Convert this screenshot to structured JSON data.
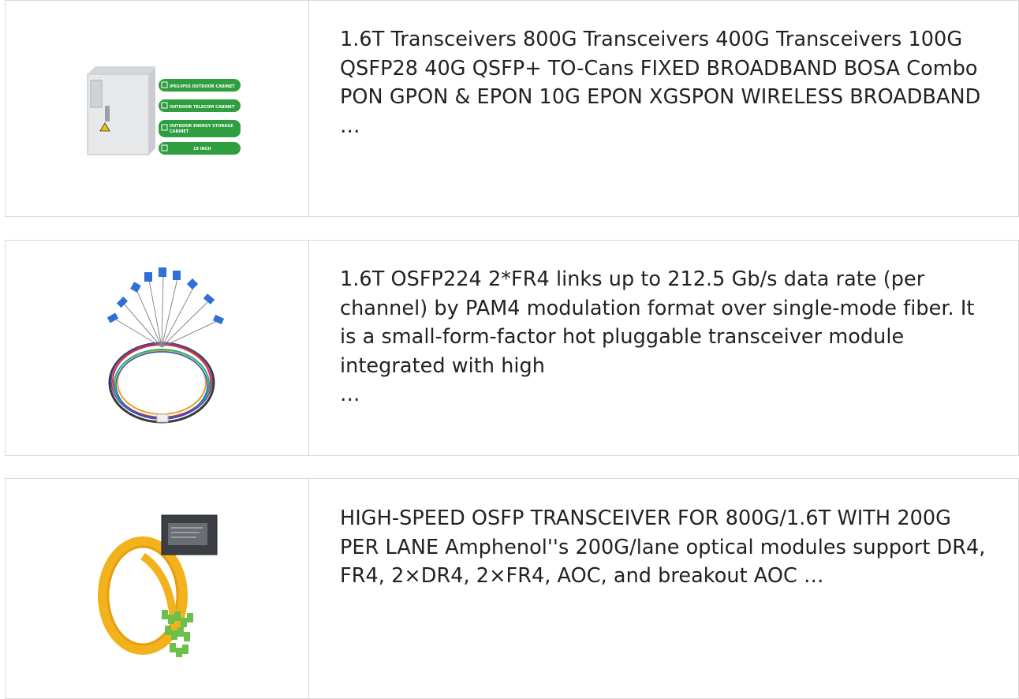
{
  "products": [
    {
      "image_caption": {
        "tags": [
          "IP65/IP55 OUTDOOR CABINET",
          "OUTDOOR TELECOM CABINET",
          "OUTDOOR ENERGY STORAGE CABINET",
          "19 INCH"
        ]
      },
      "text": "1.6T Transceivers 800G Transceivers 400G Transceivers 100G QSFP28 40G QSFP+ TO-Cans FIXED BROADBAND BOSA Combo PON GPON & EPON 10G EPON XGSPON WIRELESS BROADBAND",
      "ellipsis": "…"
    },
    {
      "text": "1.6T OSFP224 2*FR4 links up to 212.5 Gb/s data rate (per channel) by PAM4 modulation format over single-mode fiber. It is a small-form-factor hot pluggable transceiver module integrated with high",
      "ellipsis": "…"
    },
    {
      "text": "HIGH-SPEED OSFP TRANSCEIVER FOR 800G/1.6T WITH 200G PER LANE Amphenol''s 200G/lane optical modules support DR4, FR4, 2×DR4, 2×FR4, AOC, and breakout AOC …"
    }
  ],
  "colors": {
    "border": "#d9d9d9",
    "tag_green": "#2e9e3f",
    "connector_blue": "#2f6fd6",
    "connector_green": "#6cc04a",
    "fiber_yellow": "#f2b21c"
  }
}
